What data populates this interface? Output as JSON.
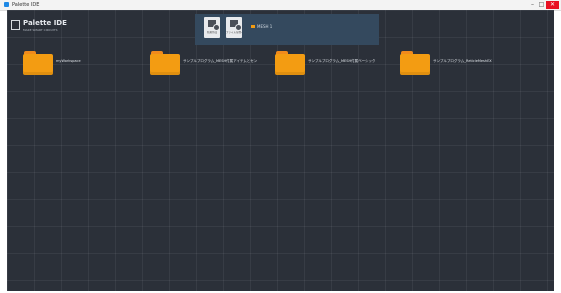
{
  "window": {
    "title": "Palette IDE",
    "minimize": "–",
    "maximize": "□",
    "close": "✕"
  },
  "app": {
    "name": "Palette IDE",
    "subtitle": "MAKE SMART CIRCUITS"
  },
  "toolbar": {
    "button_1_label": "新規作成",
    "button_2_label": "ファイルを開く",
    "status_text": "MESH 1",
    "status_color": "#f39c12"
  },
  "folders": [
    {
      "label": "myWorkspace"
    },
    {
      "label": "サンプルプログラム_MESH付属アイテムとセン"
    },
    {
      "label": "サンプルプログラム_MESH付属ベーシック"
    },
    {
      "label": "サンプルプログラム_ReticleMeshEX"
    }
  ],
  "colors": {
    "background": "#2b3039",
    "toolbar": "#34495e",
    "folder": "#f39c12"
  }
}
